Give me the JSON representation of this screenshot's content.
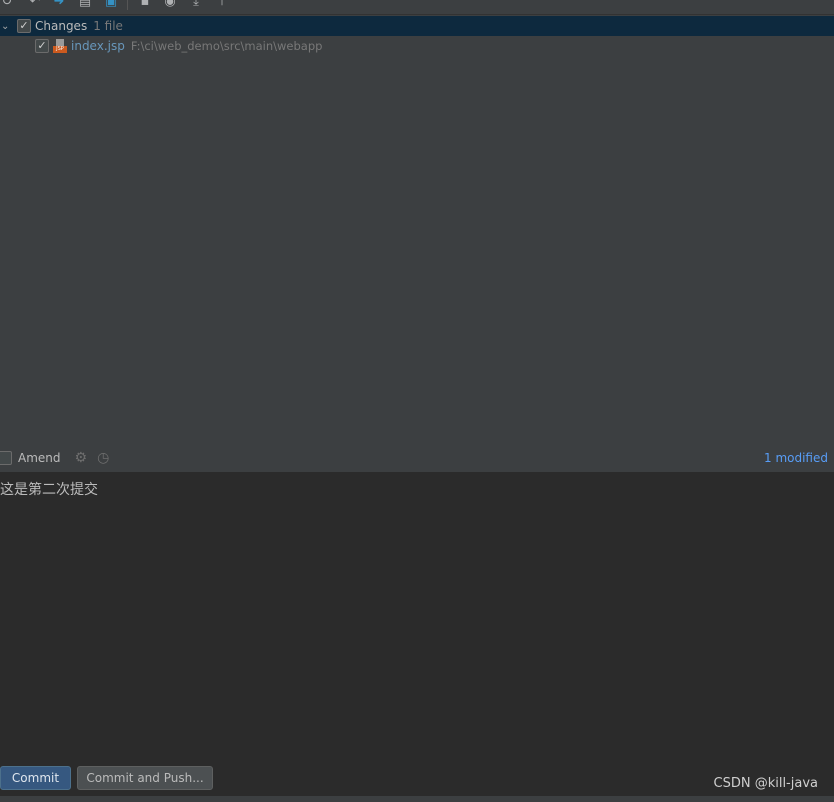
{
  "toolbar": {
    "icons": [
      "refresh-icon",
      "rollback-icon",
      "show-diff-icon",
      "shelve-icon",
      "update-icon",
      "group-by-icon",
      "view-options-icon",
      "expand-all-icon",
      "collapse-all-icon"
    ]
  },
  "changes": {
    "group_label": "Changes",
    "count": "1 file",
    "files": [
      {
        "name": "index.jsp",
        "path": "F:\\ci\\web_demo\\src\\main\\webapp",
        "type_badge": "JSP"
      }
    ]
  },
  "options": {
    "amend_label": "Amend",
    "status": "1 modified"
  },
  "commit": {
    "message": "这是第二次提交",
    "commit_label": "Commit",
    "commit_push_label": "Commit and Push..."
  },
  "watermark": "CSDN @kill-java",
  "colors": {
    "accent": "#365880",
    "link": "#589df6",
    "file": "#6897bb"
  }
}
